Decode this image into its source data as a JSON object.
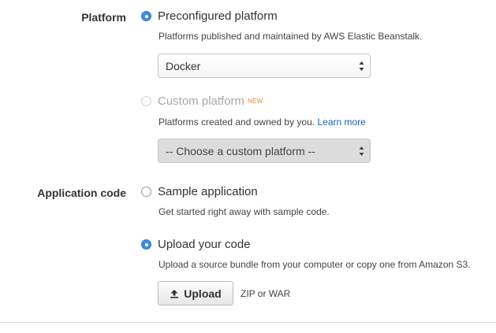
{
  "platform": {
    "label": "Platform",
    "preconfigured": {
      "label": "Preconfigured platform",
      "help": "Platforms published and maintained by AWS Elastic Beanstalk.",
      "select_value": "Docker",
      "checked": true
    },
    "custom": {
      "label": "Custom platform",
      "badge": "NEW",
      "help": "Platforms created and owned by you.",
      "help_link": "Learn more",
      "select_value": "-- Choose a custom platform --",
      "disabled": true
    }
  },
  "application_code": {
    "label": "Application code",
    "sample": {
      "label": "Sample application",
      "help": "Get started right away with sample code.",
      "checked": false
    },
    "upload": {
      "label": "Upload your code",
      "help": "Upload a source bundle from your computer or copy one from Amazon S3.",
      "checked": true,
      "button_label": "Upload",
      "button_icon": "upload-icon",
      "hint": "ZIP or WAR"
    }
  },
  "colors": {
    "radio_checked": "#3d8ee6",
    "link": "#1166bb",
    "new_badge": "#e8882a"
  }
}
